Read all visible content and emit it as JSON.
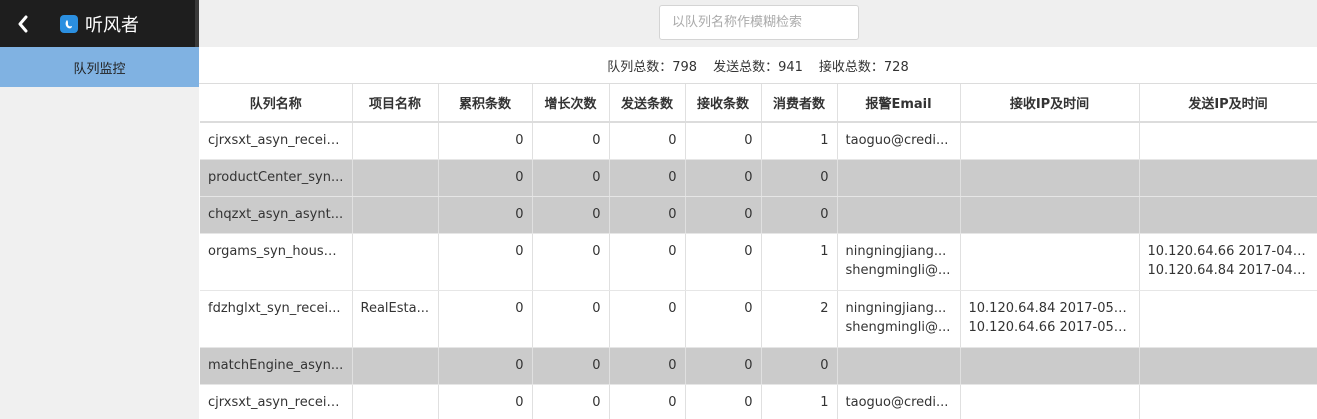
{
  "app": {
    "title": "听风者"
  },
  "sidebar": {
    "items": [
      {
        "label": "队列监控"
      }
    ]
  },
  "search": {
    "placeholder": "以队列名称作模糊检索"
  },
  "summary": {
    "queue_total": "队列总数：798",
    "send_total": "发送总数：941",
    "receive_total": "接收总数：728"
  },
  "table": {
    "headers": [
      "队列名称",
      "项目名称",
      "累积条数",
      "增长次数",
      "发送条数",
      "接收条数",
      "消费者数",
      "报警Email",
      "接收IP及时间",
      "发送IP及时间"
    ],
    "rows": [
      {
        "highlight": false,
        "tall": false,
        "queue": "cjrxsxt_asyn_receiv...",
        "project": "",
        "accum": "0",
        "growth": "0",
        "sent": "0",
        "received": "0",
        "consumers": "1",
        "email": [
          "taoguo@credi..."
        ],
        "recv_ip": [],
        "send_ip": []
      },
      {
        "highlight": true,
        "tall": false,
        "queue": "productCenter_syn...",
        "project": "",
        "accum": "0",
        "growth": "0",
        "sent": "0",
        "received": "0",
        "consumers": "0",
        "email": [],
        "recv_ip": [],
        "send_ip": []
      },
      {
        "highlight": true,
        "tall": false,
        "queue": "chqzxt_asyn_asynt...",
        "project": "",
        "accum": "0",
        "growth": "0",
        "sent": "0",
        "received": "0",
        "consumers": "0",
        "email": [],
        "recv_ip": [],
        "send_ip": []
      },
      {
        "highlight": false,
        "tall": true,
        "queue": "orgams_syn_house...",
        "project": "",
        "accum": "0",
        "growth": "0",
        "sent": "0",
        "received": "0",
        "consumers": "1",
        "email": [
          "ningningjiang...",
          "shengmingli@..."
        ],
        "recv_ip": [],
        "send_ip": [
          "10.120.64.66 2017-04-...",
          "10.120.64.84 2017-04-..."
        ]
      },
      {
        "highlight": false,
        "tall": true,
        "queue": "fdzhglxt_syn_recei...",
        "project": "RealEsta...",
        "accum": "0",
        "growth": "0",
        "sent": "0",
        "received": "0",
        "consumers": "2",
        "email": [
          "ningningjiang...",
          "shengmingli@..."
        ],
        "recv_ip": [
          "10.120.64.84 2017-05-...",
          "10.120.64.66 2017-05-..."
        ],
        "send_ip": []
      },
      {
        "highlight": true,
        "tall": false,
        "queue": "matchEngine_asyn...",
        "project": "",
        "accum": "0",
        "growth": "0",
        "sent": "0",
        "received": "0",
        "consumers": "0",
        "email": [],
        "recv_ip": [],
        "send_ip": []
      },
      {
        "highlight": false,
        "tall": false,
        "queue": "cjrxsxt_asyn_receiv...",
        "project": "",
        "accum": "0",
        "growth": "0",
        "sent": "0",
        "received": "0",
        "consumers": "1",
        "email": [
          "taoguo@credi..."
        ],
        "recv_ip": [],
        "send_ip": []
      }
    ]
  },
  "colors": {
    "sidebar_active": "#80b2e2",
    "brand_bg": "#1e1e1e",
    "row_highlight": "#cbcbcb",
    "logo": "#2b8fe0"
  },
  "icons": {
    "back": "chevron-left-icon",
    "logo": "app-logo-icon"
  }
}
